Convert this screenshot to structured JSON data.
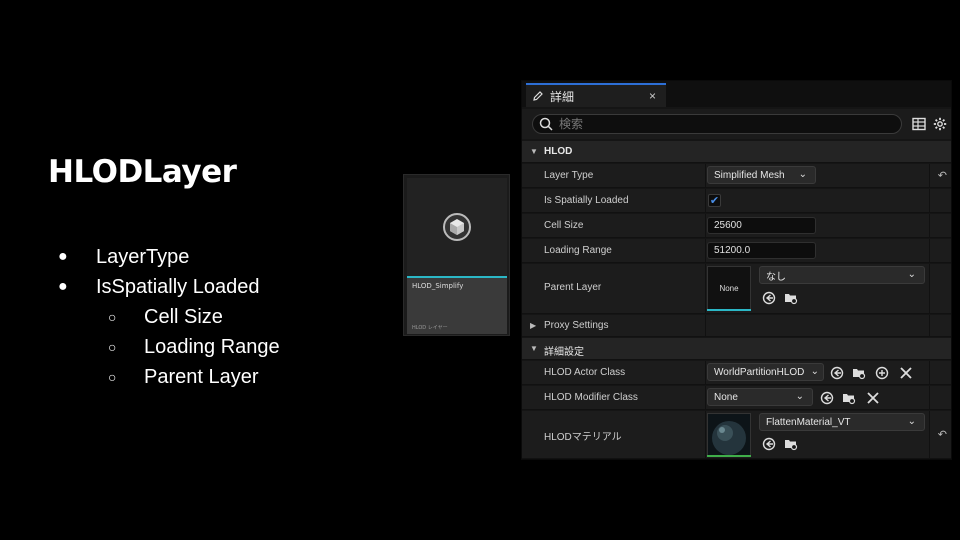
{
  "slide": {
    "title": "HLODLayer",
    "bullets": [
      {
        "mark": "●",
        "text": "LayerType"
      },
      {
        "mark": "●",
        "text": "IsSpatially Loaded"
      }
    ],
    "sub_bullets": [
      {
        "mark": "○",
        "text": "Cell Size"
      },
      {
        "mark": "○",
        "text": "Loading Range"
      },
      {
        "mark": "○",
        "text": "Parent Layer"
      }
    ]
  },
  "asset": {
    "name": "HLOD_Simplify",
    "type": "HLOD レイヤー",
    "icon": "cube-icon"
  },
  "panel": {
    "tab_title": "詳細",
    "tab_close": "×",
    "search_placeholder": "検索",
    "hlod_category": "HLOD",
    "layer_type_label": "Layer Type",
    "layer_type_value": "Simplified Mesh",
    "is_spatially_loaded_label": "Is Spatially Loaded",
    "is_spatially_loaded_checked": true,
    "cell_size_label": "Cell Size",
    "cell_size_value": "25600",
    "loading_range_label": "Loading Range",
    "loading_range_value": "51200.0",
    "parent_layer_label": "Parent Layer",
    "parent_layer_thumb": "None",
    "parent_layer_value": "なし",
    "proxy_settings_label": "Proxy Settings",
    "advanced_category": "詳細設定",
    "actor_class_label": "HLOD Actor Class",
    "actor_class_value": "WorldPartitionHLOD",
    "modifier_class_label": "HLOD Modifier Class",
    "modifier_class_value": "None",
    "material_label": "HLODマテリアル",
    "material_value": "FlattenMaterial_VT"
  },
  "colors": {
    "accent_blue": "#2d6fd6",
    "asset_bar": "#2bb7c6",
    "material_bar": "#3fae4a"
  }
}
